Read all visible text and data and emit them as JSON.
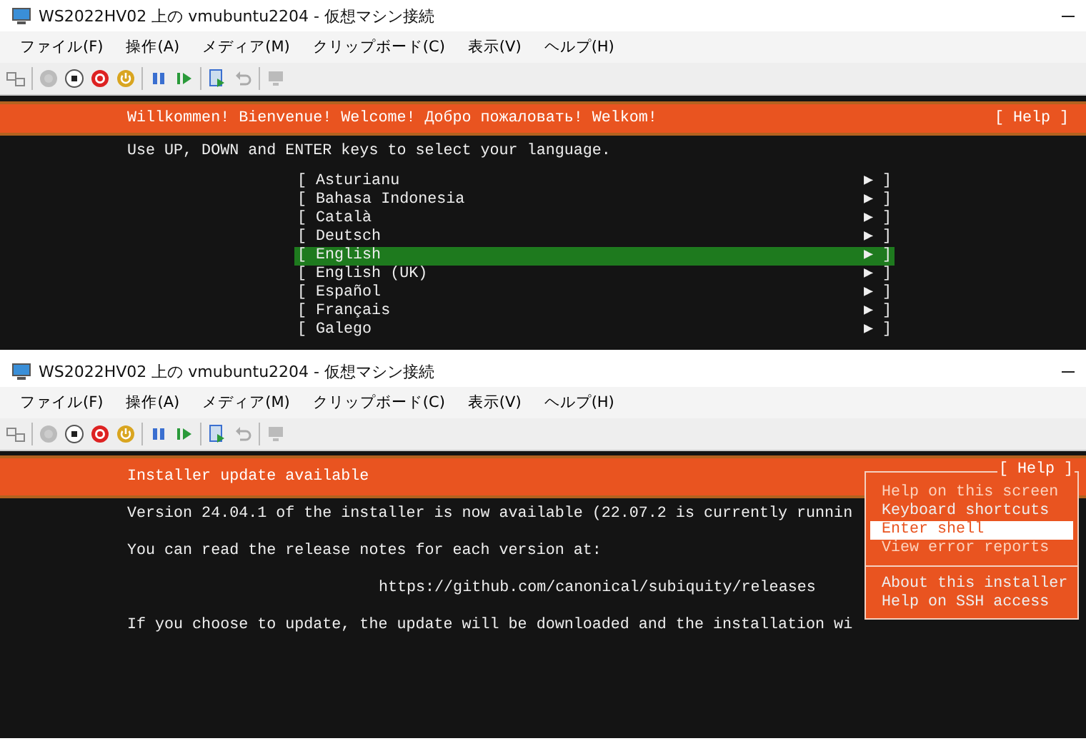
{
  "windows": [
    {
      "title": "WS2022HV02 上の vmubuntu2204 - 仮想マシン接続",
      "menus": [
        "ファイル(F)",
        "操作(A)",
        "メディア(M)",
        "クリップボード(C)",
        "表示(V)",
        "ヘルプ(H)"
      ],
      "screen": {
        "kind": "language",
        "header": "Willkommen! Bienvenue! Welcome! Добро пожаловать! Welkom!",
        "help_button": "[ Help ]",
        "instruction": "Use UP, DOWN and ENTER keys to select your language.",
        "languages": [
          {
            "name": "[ Asturianu",
            "arrow": "▶ ]",
            "selected": false
          },
          {
            "name": "[ Bahasa Indonesia",
            "arrow": "▶ ]",
            "selected": false
          },
          {
            "name": "[ Català",
            "arrow": "▶ ]",
            "selected": false
          },
          {
            "name": "[ Deutsch",
            "arrow": "▶ ]",
            "selected": false
          },
          {
            "name": "[ English",
            "arrow": "▶ ]",
            "selected": true
          },
          {
            "name": "[ English (UK)",
            "arrow": "▶ ]",
            "selected": false
          },
          {
            "name": "[ Español",
            "arrow": "▶ ]",
            "selected": false
          },
          {
            "name": "[ Français",
            "arrow": "▶ ]",
            "selected": false
          },
          {
            "name": "[ Galego",
            "arrow": "▶ ]",
            "selected": false
          }
        ]
      }
    },
    {
      "title": "WS2022HV02 上の vmubuntu2204 - 仮想マシン接続",
      "menus": [
        "ファイル(F)",
        "操作(A)",
        "メディア(M)",
        "クリップボード(C)",
        "表示(V)",
        "ヘルプ(H)"
      ],
      "screen": {
        "kind": "update",
        "header": "Installer update available",
        "lines": [
          "Version 24.04.1 of the installer is now available (22.07.2 is currently runnin",
          "You can read the release notes for each version at:",
          "https://github.com/canonical/subiquity/releases",
          "If you choose to update, the update will be downloaded and the installation wi"
        ],
        "help_menu": {
          "label": "[ Help ]",
          "groups": [
            [
              {
                "label": "Help on this screen",
                "disabled": true,
                "selected": false
              },
              {
                "label": "Keyboard shortcuts",
                "disabled": false,
                "selected": false
              },
              {
                "label": "Enter shell",
                "disabled": false,
                "selected": true
              },
              {
                "label": "View error reports",
                "disabled": true,
                "selected": false
              }
            ],
            [
              {
                "label": "About this installer",
                "disabled": false,
                "selected": false
              },
              {
                "label": "Help on SSH access",
                "disabled": false,
                "selected": false
              }
            ]
          ]
        }
      }
    }
  ]
}
